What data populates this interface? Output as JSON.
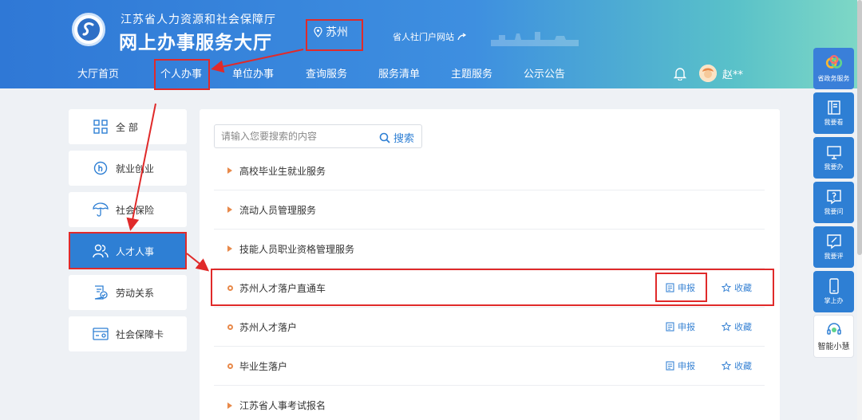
{
  "header": {
    "org_name": "江苏省人力资源和社会保障厅",
    "site_name": "网上办事服务大厅",
    "city": "苏州",
    "portal_link": "省人社门户网站",
    "user_name": "赵**"
  },
  "nav": {
    "items": [
      {
        "label": "大厅首页"
      },
      {
        "label": "个人办事"
      },
      {
        "label": "单位办事"
      },
      {
        "label": "查询服务"
      },
      {
        "label": "服务清单"
      },
      {
        "label": "主题服务"
      },
      {
        "label": "公示公告"
      }
    ],
    "active_index": 1
  },
  "menu": {
    "items": [
      {
        "label": "全 部",
        "icon": "grid-icon"
      },
      {
        "label": "就业创业",
        "icon": "employment-icon"
      },
      {
        "label": "社会保险",
        "icon": "umbrella-icon"
      },
      {
        "label": "人才人事",
        "icon": "people-icon"
      },
      {
        "label": "劳动关系",
        "icon": "contract-icon"
      },
      {
        "label": "社会保障卡",
        "icon": "card-icon"
      }
    ],
    "active_index": 3
  },
  "search": {
    "placeholder": "请输入您要搜索的内容",
    "button_label": "搜索"
  },
  "services": [
    {
      "title": "高校毕业生就业服务",
      "marker": "triangle"
    },
    {
      "title": "流动人员管理服务",
      "marker": "triangle"
    },
    {
      "title": "技能人员职业资格管理服务",
      "marker": "triangle"
    },
    {
      "title": "苏州人才落户直通车",
      "marker": "circle",
      "apply": "申报",
      "favorite": "收藏"
    },
    {
      "title": "苏州人才落户",
      "marker": "circle",
      "apply": "申报",
      "favorite": "收藏"
    },
    {
      "title": "毕业生落户",
      "marker": "circle",
      "apply": "申报",
      "favorite": "收藏"
    },
    {
      "title": "江苏省人事考试报名",
      "marker": "triangle"
    }
  ],
  "float_bar": {
    "items": [
      {
        "label": "省政务服务",
        "icon": "government-service-icon"
      },
      {
        "label": "我要看",
        "icon": "book-icon"
      },
      {
        "label": "我要办",
        "icon": "monitor-icon"
      },
      {
        "label": "我要问",
        "icon": "question-icon"
      },
      {
        "label": "我要评",
        "icon": "comment-edit-icon"
      },
      {
        "label": "掌上办",
        "icon": "mobile-icon"
      },
      {
        "label": "智能小慧",
        "icon": "headset-icon"
      }
    ]
  },
  "colors": {
    "primary": "#2e7fd4",
    "accent_orange": "#e8894a",
    "annotation_red": "#e02a2a"
  }
}
